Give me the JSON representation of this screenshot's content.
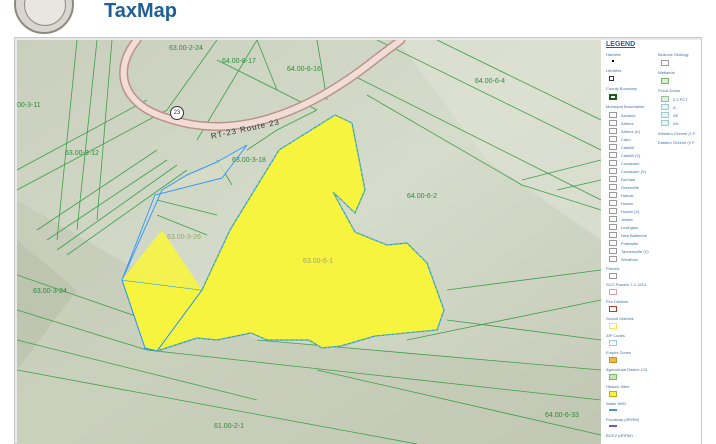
{
  "header": {
    "title": "TaxMap"
  },
  "map": {
    "parcel_labels": [
      "63.00-2-24",
      "64.00-8-17",
      "64.00-6-16",
      "64.00-6-4",
      "00-3-11",
      "63.00-3-12",
      "63.00-3-18",
      "64.00-6-2",
      "63.00-3-26",
      "63.00-6-1",
      "63.00-3-24",
      "64.00-6-33",
      "61.00-2-1"
    ],
    "road_label": "RT-23  Route 23",
    "route_shield": "23",
    "colors": {
      "background": "#cfd6c4",
      "parcel_line": "#3e9e4a",
      "selected_fill": "#f7f440",
      "selected_outline": "#1e90ff",
      "road": "#e8c8c0"
    }
  },
  "legend": {
    "title": "LEGEND",
    "col1": [
      "Hamlets",
      "Libraries",
      "County Boundary",
      "Municipal Boundaries",
      "Ashland",
      "Athens",
      "Athens (V)",
      "Cairo",
      "Catskill",
      "Catskill (V)",
      "Coxsackie",
      "Coxsackie (V)",
      "Durham",
      "Greenville",
      "Halcott",
      "Hunter",
      "Hunter (V)",
      "Jewett",
      "Lexington",
      "New Baltimore",
      "Prattsville",
      "Tannersville (V)",
      "Windham",
      "Parcels",
      "SCO Parcels 7-1-2014",
      "Fire Districts",
      "School Districts",
      "ZIP Codes",
      "Empire Zones",
      "Agricultural District 124",
      "Historic Sites",
      "Water NHD",
      "Floodway (dFIRM)",
      "BCEV (dFIRM)"
    ],
    "col2": [
      "Bedrock Geology",
      "Wetlands",
      "Flood Zones",
      "0.2 PCT",
      "A",
      "AE",
      "AH",
      "Western Greene (1 F",
      "Eastern Greene (2 F"
    ]
  }
}
